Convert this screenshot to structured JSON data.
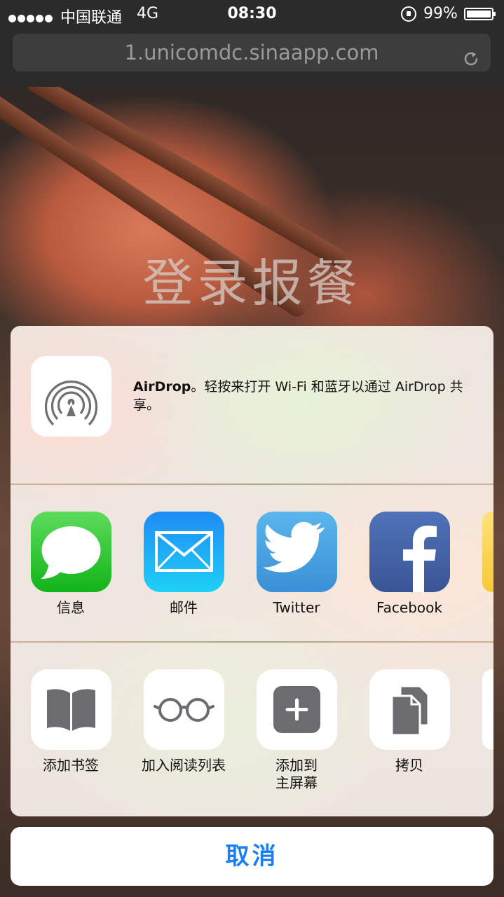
{
  "status_bar": {
    "carrier": "中国联通",
    "network": "4G",
    "time": "08:30",
    "battery": "99%",
    "battery_level": 0.99,
    "signal_bars": 5
  },
  "url_bar": {
    "url": "1.unicomdc.sinaapp.com",
    "reload_icon": "reload-icon"
  },
  "page": {
    "title": "登录报餐"
  },
  "share_sheet": {
    "airdrop": {
      "title": "AirDrop",
      "description": "。轻按来打开 Wi-Fi 和蓝牙以通过 AirDrop 共享。",
      "icon": "airdrop-icon"
    },
    "apps": [
      {
        "label": "信息",
        "icon": "messages-icon"
      },
      {
        "label": "邮件",
        "icon": "mail-icon"
      },
      {
        "label": "Twitter",
        "icon": "twitter-icon"
      },
      {
        "label": "Facebook",
        "icon": "facebook-icon"
      }
    ],
    "actions": [
      {
        "label": "添加书签",
        "icon": "bookmark-icon"
      },
      {
        "label": "加入阅读列表",
        "icon": "glasses-icon"
      },
      {
        "label": "添加到\n主屏幕",
        "icon": "add-icon"
      },
      {
        "label": "拷贝",
        "icon": "copy-icon"
      }
    ]
  },
  "cancel": {
    "label": "取消"
  },
  "colors": {
    "accent": "#1a7ff3",
    "messages": "#12b41a",
    "mail": "#1f8bf5",
    "twitter": "#3a8fd5",
    "facebook": "#3a5596"
  }
}
